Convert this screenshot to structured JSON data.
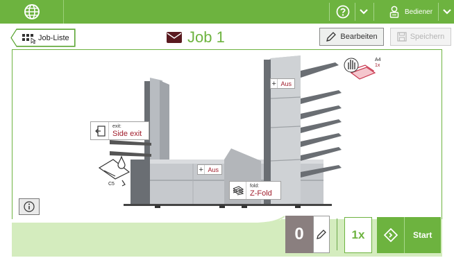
{
  "topbar": {
    "user_label": "Bediener"
  },
  "header": {
    "joblist_label": "Job-Liste",
    "job_title": "Job 1",
    "edit_label": "Bearbeiten",
    "save_label": "Speichern"
  },
  "machine": {
    "exit_caption": "exit:",
    "exit_value": "Side exit",
    "fold_caption": "fold:",
    "fold_value": "Z-Fold",
    "upper_toggle_state": "Aus",
    "lower_toggle_state": "Aus",
    "envelope_size": "C5",
    "doc_size": "A4",
    "doc_count": "1x"
  },
  "bottom": {
    "counter_value": "0",
    "repeat_label": "1x",
    "start_label": "Start"
  },
  "colors": {
    "brand_green": "#6db33f",
    "bottom_strip": "#d4ecbe",
    "accent_red": "#a01d2c",
    "counter_gray": "#8a7f7f"
  },
  "icons": [
    "globe-icon",
    "help-icon",
    "chevron-down-icon",
    "user-icon",
    "envelope-icon",
    "pencil-icon",
    "save-icon",
    "joblist-icon",
    "exit-icon",
    "fold-icon",
    "plus-icon",
    "info-icon",
    "start-icon",
    "hand-icon",
    "ink-drop-icon"
  ]
}
